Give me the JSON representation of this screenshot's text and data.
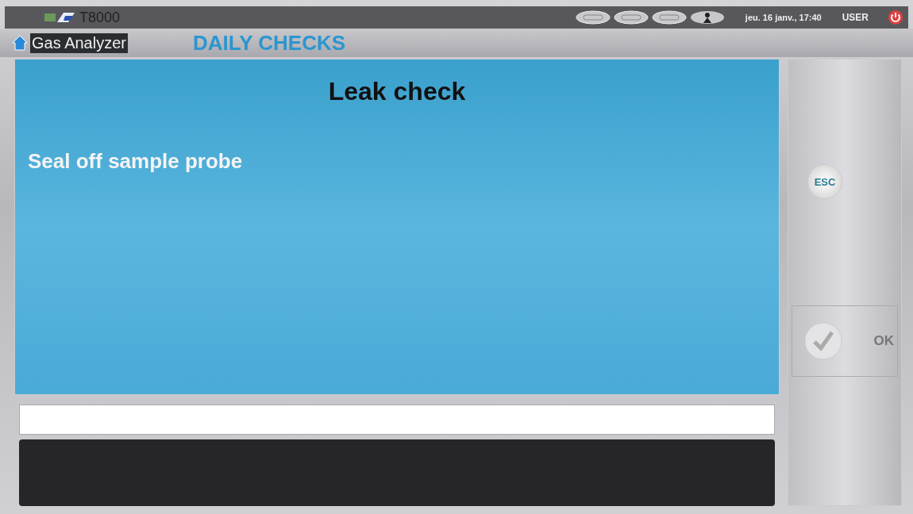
{
  "top_bar": {
    "device": "T8000",
    "datetime": "jeu. 16 janv., 17:40",
    "user": "USER"
  },
  "header": {
    "app": "Gas Analyzer",
    "title": "DAILY CHECKS"
  },
  "panel": {
    "title": "Leak check",
    "message": "Seal off sample probe"
  },
  "buttons": [
    {
      "kind": "esc",
      "label": "ESC"
    },
    {
      "kind": "ok",
      "label": "OK"
    }
  ]
}
